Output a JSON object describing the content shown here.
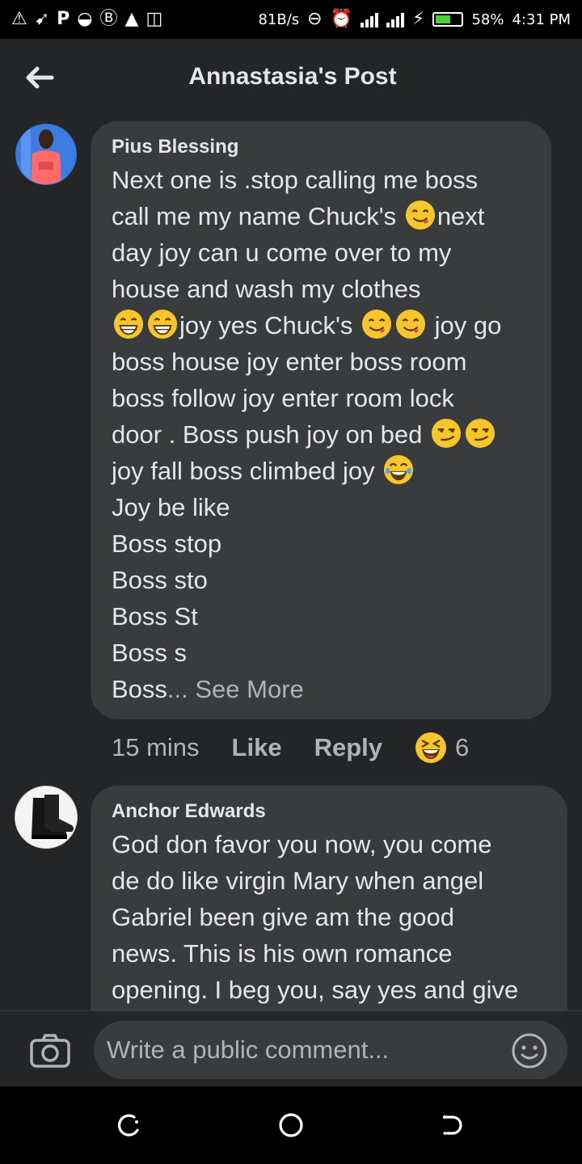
{
  "status_bar": {
    "left_icons": [
      "warning-triangle-icon",
      "app-icon",
      "p-icon",
      "app-icon",
      "b-icon",
      "alert-icon",
      "screenshot-icon"
    ],
    "net_speed": "81B/s",
    "battery": "58%",
    "battery_level": 0.58,
    "time": "4:31 PM"
  },
  "header": {
    "title": "Annastasia's Post",
    "back_icon": "arrow-left-icon"
  },
  "comments": [
    {
      "author": "Pius Blessing",
      "lines": [
        "Next one is .stop calling me boss",
        "call me my name Chuck's",
        "next",
        "day joy can u come over to my",
        "house and wash my clothes",
        "joy yes Chuck's",
        "joy go",
        "boss house joy enter boss room",
        "boss follow joy enter room lock",
        "door . Boss push joy on bed",
        "joy fall boss climbed joy",
        "Joy be like",
        "Boss stop",
        "Boss sto",
        "Boss St",
        "Boss s",
        "Boss",
        "... See More"
      ],
      "time": "15 mins",
      "like": "Like",
      "reply": "Reply",
      "reaction_count": "6"
    },
    {
      "author": "Anchor Edwards",
      "lines": [
        "God don favor you now, you come",
        "de do like virgin Mary when angel",
        "Gabriel been give am the good",
        "news. This is his own romance",
        "opening. I beg you, say yes and give"
      ]
    }
  ],
  "composer": {
    "placeholder": "Write a public comment...",
    "camera_icon": "camera-icon",
    "emoji_icon": "smiley-icon"
  },
  "nav": {
    "icons": [
      "recent-apps-icon",
      "home-icon",
      "back-icon"
    ]
  }
}
